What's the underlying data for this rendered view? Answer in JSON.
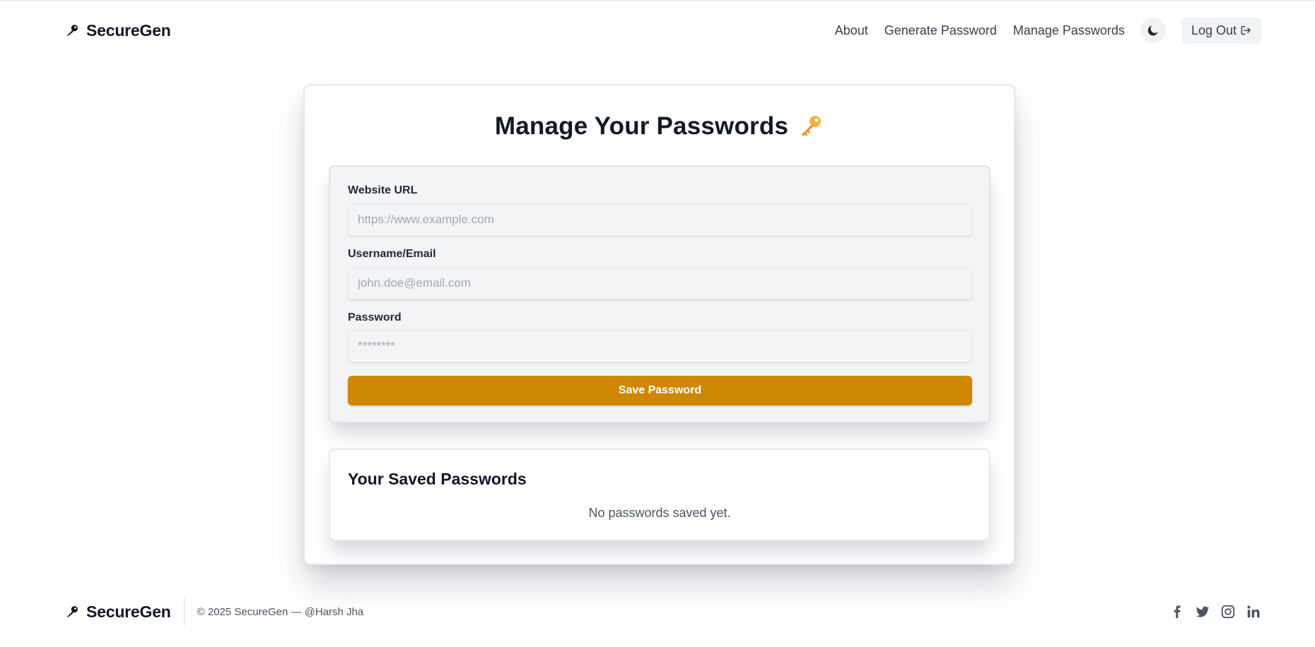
{
  "header": {
    "brand": "SecureGen",
    "nav": [
      "About",
      "Generate Password",
      "Manage Passwords"
    ],
    "logout_label": "Log Out"
  },
  "main": {
    "title": "Manage Your Passwords",
    "form": {
      "url_label": "Website URL",
      "url_placeholder": "https://www.example.com",
      "user_label": "Username/Email",
      "user_placeholder": "john.doe@email.com",
      "password_label": "Password",
      "password_placeholder": "********",
      "save_label": "Save Password"
    },
    "saved": {
      "title": "Your Saved Passwords",
      "empty_text": "No passwords saved yet."
    }
  },
  "footer": {
    "brand": "SecureGen",
    "copyright": "© 2025 SecureGen — @Harsh Jha",
    "socials": [
      "facebook-icon",
      "twitter-icon",
      "instagram-icon",
      "linkedin-icon"
    ]
  },
  "colors": {
    "accent": "#ce8701",
    "text": "#111827",
    "muted": "#4b5563"
  }
}
